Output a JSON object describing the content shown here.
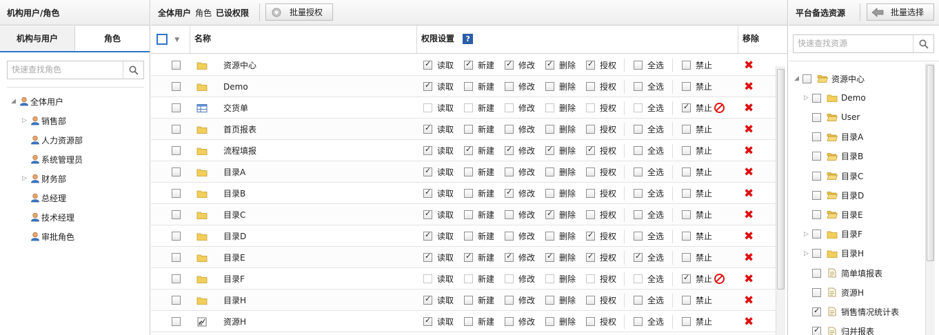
{
  "left": {
    "title": "机构用户/角色",
    "tabs": [
      "机构与用户",
      "角色"
    ],
    "search_placeholder": "快速查找角色",
    "tree": [
      {
        "label": "全体用户",
        "level": 0,
        "expander": "expanded"
      },
      {
        "label": "销售部",
        "level": 1,
        "expander": "collapsed"
      },
      {
        "label": "人力资源部",
        "level": 1,
        "expander": "none"
      },
      {
        "label": "系统管理员",
        "level": 1,
        "expander": "none"
      },
      {
        "label": "财务部",
        "level": 1,
        "expander": "collapsed"
      },
      {
        "label": "总经理",
        "level": 1,
        "expander": "none"
      },
      {
        "label": "技术经理",
        "level": 1,
        "expander": "none"
      },
      {
        "label": "审批角色",
        "level": 1,
        "expander": "none"
      }
    ]
  },
  "mid": {
    "header": {
      "name": "全体用户",
      "type": "角色",
      "status": "已设权限",
      "batch_button": "批量授权"
    },
    "columns": {
      "name": "名称",
      "perms": "权限设置",
      "remove": "移除"
    },
    "perm_labels": [
      "读取",
      "新建",
      "修改",
      "删除",
      "授权"
    ],
    "all_label": "全选",
    "ban_label": "禁止",
    "rows": [
      {
        "name": "资源中心",
        "icon": "folder",
        "perms": [
          1,
          1,
          1,
          1,
          1
        ],
        "all": 0,
        "ban": 0,
        "banned": false
      },
      {
        "name": "Demo",
        "icon": "folder",
        "perms": [
          1,
          0,
          0,
          0,
          0
        ],
        "all": 0,
        "ban": 0,
        "banned": false
      },
      {
        "name": "交货单",
        "icon": "table",
        "perms": [
          0,
          0,
          0,
          0,
          0
        ],
        "all": 0,
        "ban": 1,
        "banned": true
      },
      {
        "name": "首页报表",
        "icon": "folder",
        "perms": [
          1,
          0,
          0,
          0,
          0
        ],
        "all": 0,
        "ban": 0,
        "banned": false
      },
      {
        "name": "流程填报",
        "icon": "folder",
        "perms": [
          1,
          1,
          1,
          1,
          1
        ],
        "all": 0,
        "ban": 0,
        "banned": false
      },
      {
        "name": "目录A",
        "icon": "folder",
        "perms": [
          1,
          0,
          0,
          0,
          0
        ],
        "all": 0,
        "ban": 0,
        "banned": false
      },
      {
        "name": "目录B",
        "icon": "folder",
        "perms": [
          1,
          0,
          1,
          0,
          0
        ],
        "all": 0,
        "ban": 0,
        "banned": false
      },
      {
        "name": "目录C",
        "icon": "folder",
        "perms": [
          1,
          0,
          0,
          1,
          0
        ],
        "all": 0,
        "ban": 0,
        "banned": false
      },
      {
        "name": "目录D",
        "icon": "folder",
        "perms": [
          1,
          0,
          0,
          0,
          1
        ],
        "all": 0,
        "ban": 0,
        "banned": false
      },
      {
        "name": "目录E",
        "icon": "folder",
        "perms": [
          1,
          1,
          1,
          1,
          1
        ],
        "all": 1,
        "ban": 0,
        "banned": false
      },
      {
        "name": "目录F",
        "icon": "folder",
        "perms": [
          0,
          0,
          0,
          0,
          0
        ],
        "all": 0,
        "ban": 1,
        "banned": true
      },
      {
        "name": "目录H",
        "icon": "folder",
        "perms": [
          1,
          0,
          0,
          0,
          0
        ],
        "all": 0,
        "ban": 0,
        "banned": false
      },
      {
        "name": "资源H",
        "icon": "chart",
        "perms": [
          1,
          0,
          0,
          0,
          0
        ],
        "all": 0,
        "ban": 0,
        "banned": false
      }
    ]
  },
  "right": {
    "title": "平台备选资源",
    "batch_button": "批量选择",
    "search_placeholder": "快速查找资源",
    "tree": [
      {
        "label": "资源中心",
        "level": 0,
        "expander": "expanded",
        "icon": "folder-open",
        "checked": false
      },
      {
        "label": "Demo",
        "level": 1,
        "expander": "collapsed",
        "icon": "folder",
        "checked": false
      },
      {
        "label": "User",
        "level": 1,
        "expander": "none",
        "icon": "folder-open",
        "checked": false
      },
      {
        "label": "目录A",
        "level": 1,
        "expander": "none",
        "icon": "folder-open",
        "checked": false
      },
      {
        "label": "目录B",
        "level": 1,
        "expander": "none",
        "icon": "folder-open",
        "checked": false
      },
      {
        "label": "目录C",
        "level": 1,
        "expander": "none",
        "icon": "folder-open",
        "checked": false
      },
      {
        "label": "目录D",
        "level": 1,
        "expander": "none",
        "icon": "folder-open",
        "checked": false
      },
      {
        "label": "目录E",
        "level": 1,
        "expander": "none",
        "icon": "folder-open",
        "checked": false
      },
      {
        "label": "目录F",
        "level": 1,
        "expander": "collapsed",
        "icon": "folder",
        "checked": false
      },
      {
        "label": "目录H",
        "level": 1,
        "expander": "collapsed",
        "icon": "folder",
        "checked": false
      },
      {
        "label": "简单填报表",
        "level": 1,
        "expander": "none",
        "icon": "doc",
        "checked": false
      },
      {
        "label": "资源H",
        "level": 1,
        "expander": "none",
        "icon": "doc",
        "checked": false
      },
      {
        "label": "销售情况统计表",
        "level": 1,
        "expander": "none",
        "icon": "doc",
        "checked": true
      },
      {
        "label": "归并报表",
        "level": 1,
        "expander": "none",
        "icon": "doc",
        "checked": true
      }
    ]
  }
}
